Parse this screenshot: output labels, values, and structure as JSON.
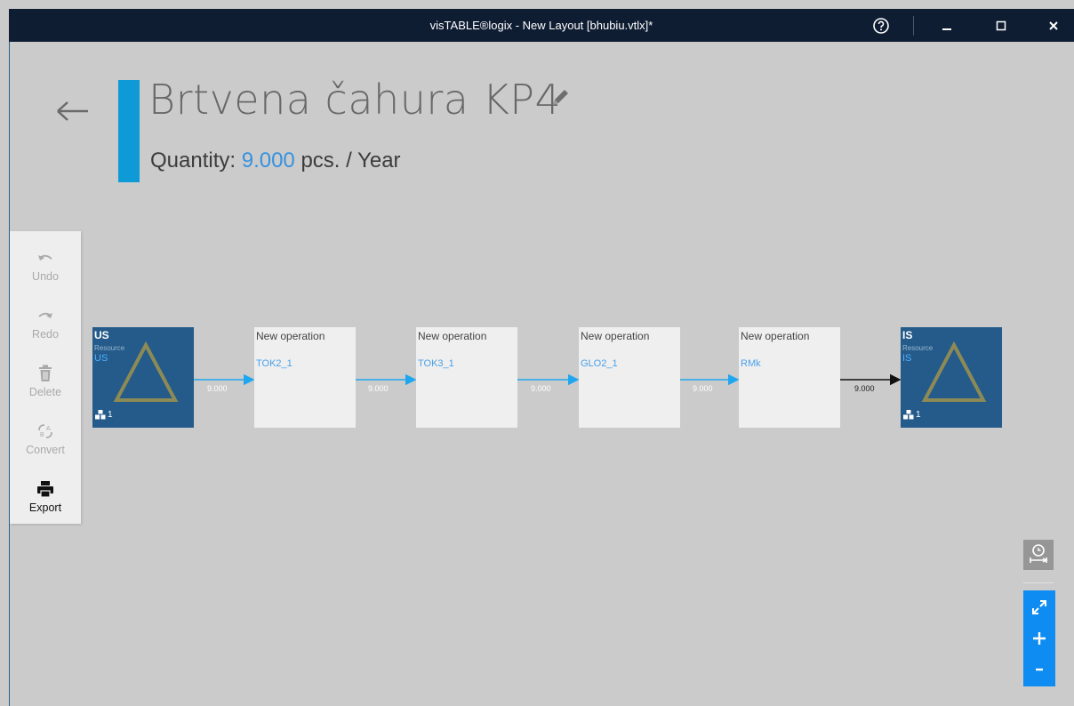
{
  "titlebar": {
    "title": "visTABLE®logix - New Layout [bhubiu.vtlx]*"
  },
  "header": {
    "title": "Brtvena čahura KP4",
    "quantity_label": "Quantity:",
    "quantity_value": "9.000",
    "quantity_unit": "pcs. / Year",
    "accent_color": "#0e9ad6"
  },
  "toolbar": {
    "undo": "Undo",
    "redo": "Redo",
    "delete": "Delete",
    "convert": "Convert",
    "export": "Export"
  },
  "flow": {
    "source": {
      "name": "US",
      "type": "Resource",
      "code": "US",
      "count": "1"
    },
    "operations": [
      {
        "name": "New operation",
        "code": "TOK2_1"
      },
      {
        "name": "New operation",
        "code": "TOK3_1"
      },
      {
        "name": "New operation",
        "code": "GLO2_1"
      },
      {
        "name": "New operation",
        "code": "RMk"
      }
    ],
    "sink": {
      "name": "IS",
      "type": "Resource",
      "code": "IS",
      "count": "1"
    },
    "flow_values": [
      "9.000",
      "9.000",
      "9.000",
      "9.000",
      "9.000"
    ]
  },
  "colors": {
    "resource_bg": "#245b8a",
    "flow_line": "#1ea7f0",
    "zoom_panel": "#0f8cf2"
  }
}
